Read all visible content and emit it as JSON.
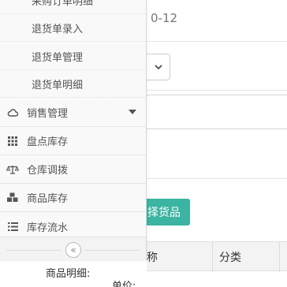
{
  "sidebar": {
    "submenu": [
      "采购订单明细",
      "退货单录入",
      "退货单管理",
      "退货单明细"
    ],
    "menu": [
      {
        "label": "销售管理",
        "icon": "cloud-icon"
      },
      {
        "label": "盘点库存",
        "icon": "grid-icon"
      },
      {
        "label": "仓库调拨",
        "icon": "balance-scale-icon"
      },
      {
        "label": "商品库存",
        "icon": "cubes-icon"
      },
      {
        "label": "库存流水",
        "icon": "list-icon"
      }
    ],
    "collapse_glyph": "«"
  },
  "form": {
    "date_fragment": "0-12",
    "select_button_label": "择货品",
    "table_headers": [
      "称",
      "分类"
    ],
    "detail_label": "商品明细:",
    "price_label": "单价:"
  },
  "colors": {
    "accent": "#3bb4a1"
  }
}
